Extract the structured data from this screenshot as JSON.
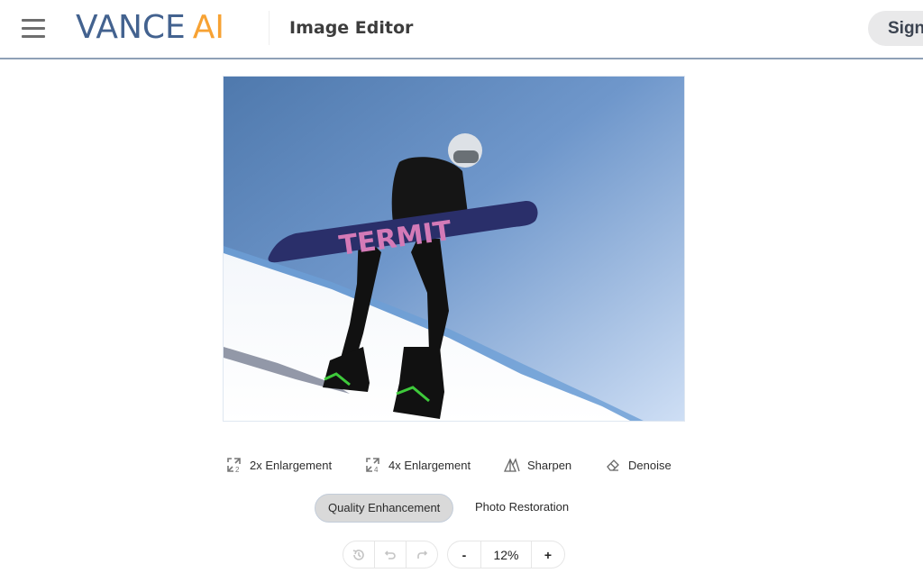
{
  "header": {
    "menu_icon": "hamburger-icon",
    "logo_part1": "VANCE",
    "logo_part2": "AI",
    "title": "Image Editor",
    "sign_button": "Sign"
  },
  "colors": {
    "brand_blue": "#43628f",
    "brand_orange": "#f7a233",
    "header_border": "#8fa0b6",
    "active_mode_bg": "#d9d9d9"
  },
  "canvas": {
    "image_description": "Snowboarder walking up a snowy slope carrying a navy snowboard with pink and teal lettering against a blue sky",
    "board_text": "TERMIT"
  },
  "tools": [
    {
      "label": "2x Enlargement",
      "icon": "enlarge-2x-icon"
    },
    {
      "label": "4x Enlargement",
      "icon": "enlarge-4x-icon"
    },
    {
      "label": "Sharpen",
      "icon": "sharpen-icon"
    },
    {
      "label": "Denoise",
      "icon": "eraser-icon"
    }
  ],
  "modes": [
    {
      "label": "Quality Enhancement",
      "active": true
    },
    {
      "label": "Photo Restoration",
      "active": false
    }
  ],
  "history": {
    "history_icon": "history-icon",
    "undo_icon": "undo-icon",
    "redo_icon": "redo-icon"
  },
  "zoom": {
    "minus": "-",
    "value": "12%",
    "plus": "+"
  }
}
